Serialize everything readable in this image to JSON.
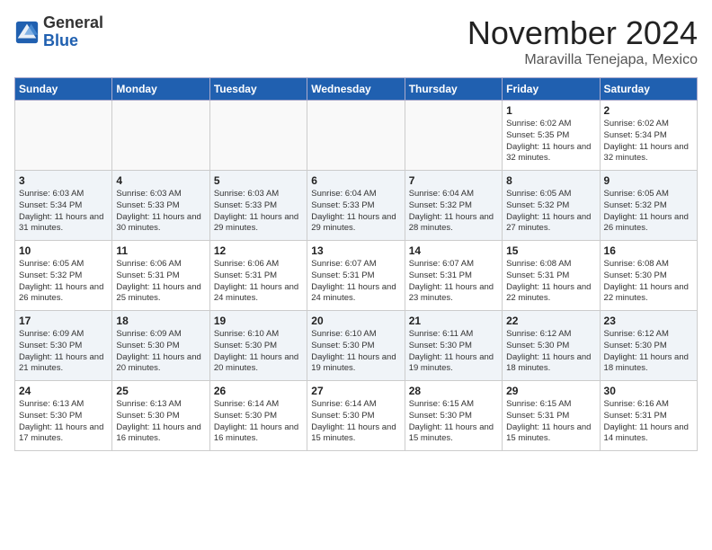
{
  "header": {
    "logo_general": "General",
    "logo_blue": "Blue",
    "month_title": "November 2024",
    "location": "Maravilla Tenejapa, Mexico"
  },
  "weekdays": [
    "Sunday",
    "Monday",
    "Tuesday",
    "Wednesday",
    "Thursday",
    "Friday",
    "Saturday"
  ],
  "weeks": [
    [
      {
        "day": "",
        "info": ""
      },
      {
        "day": "",
        "info": ""
      },
      {
        "day": "",
        "info": ""
      },
      {
        "day": "",
        "info": ""
      },
      {
        "day": "",
        "info": ""
      },
      {
        "day": "1",
        "info": "Sunrise: 6:02 AM\nSunset: 5:35 PM\nDaylight: 11 hours\nand 32 minutes."
      },
      {
        "day": "2",
        "info": "Sunrise: 6:02 AM\nSunset: 5:34 PM\nDaylight: 11 hours\nand 32 minutes."
      }
    ],
    [
      {
        "day": "3",
        "info": "Sunrise: 6:03 AM\nSunset: 5:34 PM\nDaylight: 11 hours\nand 31 minutes."
      },
      {
        "day": "4",
        "info": "Sunrise: 6:03 AM\nSunset: 5:33 PM\nDaylight: 11 hours\nand 30 minutes."
      },
      {
        "day": "5",
        "info": "Sunrise: 6:03 AM\nSunset: 5:33 PM\nDaylight: 11 hours\nand 29 minutes."
      },
      {
        "day": "6",
        "info": "Sunrise: 6:04 AM\nSunset: 5:33 PM\nDaylight: 11 hours\nand 29 minutes."
      },
      {
        "day": "7",
        "info": "Sunrise: 6:04 AM\nSunset: 5:32 PM\nDaylight: 11 hours\nand 28 minutes."
      },
      {
        "day": "8",
        "info": "Sunrise: 6:05 AM\nSunset: 5:32 PM\nDaylight: 11 hours\nand 27 minutes."
      },
      {
        "day": "9",
        "info": "Sunrise: 6:05 AM\nSunset: 5:32 PM\nDaylight: 11 hours\nand 26 minutes."
      }
    ],
    [
      {
        "day": "10",
        "info": "Sunrise: 6:05 AM\nSunset: 5:32 PM\nDaylight: 11 hours\nand 26 minutes."
      },
      {
        "day": "11",
        "info": "Sunrise: 6:06 AM\nSunset: 5:31 PM\nDaylight: 11 hours\nand 25 minutes."
      },
      {
        "day": "12",
        "info": "Sunrise: 6:06 AM\nSunset: 5:31 PM\nDaylight: 11 hours\nand 24 minutes."
      },
      {
        "day": "13",
        "info": "Sunrise: 6:07 AM\nSunset: 5:31 PM\nDaylight: 11 hours\nand 24 minutes."
      },
      {
        "day": "14",
        "info": "Sunrise: 6:07 AM\nSunset: 5:31 PM\nDaylight: 11 hours\nand 23 minutes."
      },
      {
        "day": "15",
        "info": "Sunrise: 6:08 AM\nSunset: 5:31 PM\nDaylight: 11 hours\nand 22 minutes."
      },
      {
        "day": "16",
        "info": "Sunrise: 6:08 AM\nSunset: 5:30 PM\nDaylight: 11 hours\nand 22 minutes."
      }
    ],
    [
      {
        "day": "17",
        "info": "Sunrise: 6:09 AM\nSunset: 5:30 PM\nDaylight: 11 hours\nand 21 minutes."
      },
      {
        "day": "18",
        "info": "Sunrise: 6:09 AM\nSunset: 5:30 PM\nDaylight: 11 hours\nand 20 minutes."
      },
      {
        "day": "19",
        "info": "Sunrise: 6:10 AM\nSunset: 5:30 PM\nDaylight: 11 hours\nand 20 minutes."
      },
      {
        "day": "20",
        "info": "Sunrise: 6:10 AM\nSunset: 5:30 PM\nDaylight: 11 hours\nand 19 minutes."
      },
      {
        "day": "21",
        "info": "Sunrise: 6:11 AM\nSunset: 5:30 PM\nDaylight: 11 hours\nand 19 minutes."
      },
      {
        "day": "22",
        "info": "Sunrise: 6:12 AM\nSunset: 5:30 PM\nDaylight: 11 hours\nand 18 minutes."
      },
      {
        "day": "23",
        "info": "Sunrise: 6:12 AM\nSunset: 5:30 PM\nDaylight: 11 hours\nand 18 minutes."
      }
    ],
    [
      {
        "day": "24",
        "info": "Sunrise: 6:13 AM\nSunset: 5:30 PM\nDaylight: 11 hours\nand 17 minutes."
      },
      {
        "day": "25",
        "info": "Sunrise: 6:13 AM\nSunset: 5:30 PM\nDaylight: 11 hours\nand 16 minutes."
      },
      {
        "day": "26",
        "info": "Sunrise: 6:14 AM\nSunset: 5:30 PM\nDaylight: 11 hours\nand 16 minutes."
      },
      {
        "day": "27",
        "info": "Sunrise: 6:14 AM\nSunset: 5:30 PM\nDaylight: 11 hours\nand 15 minutes."
      },
      {
        "day": "28",
        "info": "Sunrise: 6:15 AM\nSunset: 5:30 PM\nDaylight: 11 hours\nand 15 minutes."
      },
      {
        "day": "29",
        "info": "Sunrise: 6:15 AM\nSunset: 5:31 PM\nDaylight: 11 hours\nand 15 minutes."
      },
      {
        "day": "30",
        "info": "Sunrise: 6:16 AM\nSunset: 5:31 PM\nDaylight: 11 hours\nand 14 minutes."
      }
    ]
  ]
}
